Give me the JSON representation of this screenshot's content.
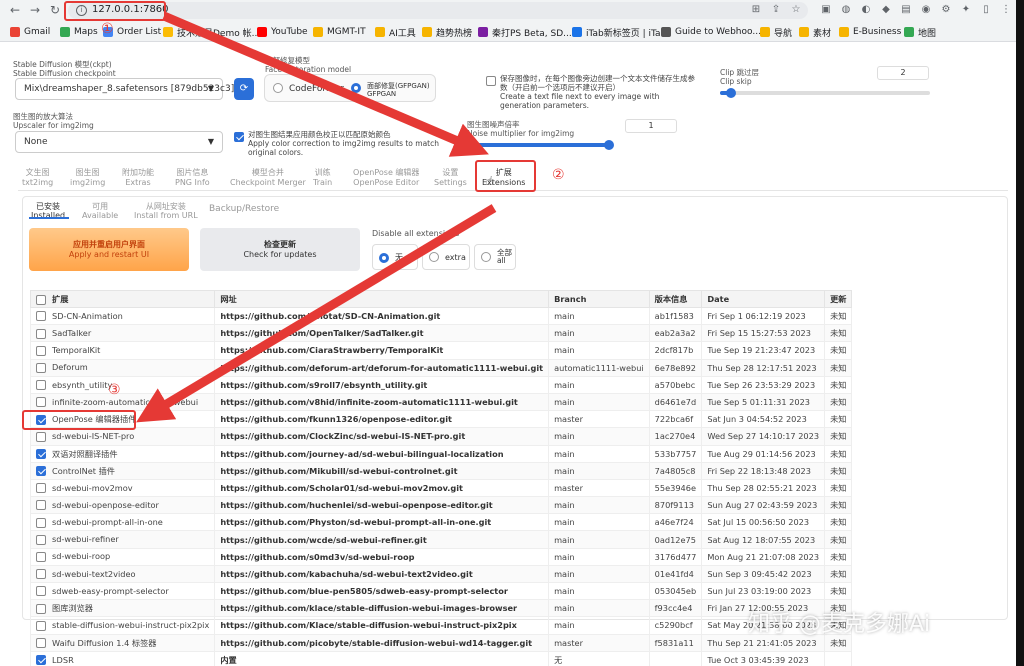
{
  "browser": {
    "url": "127.0.0.1:7860",
    "bookmarks": [
      {
        "label": "Gmail",
        "color": "#ea4335"
      },
      {
        "label": "Maps",
        "color": "#34a853"
      },
      {
        "label": "Order List",
        "color": "#4285f4"
      },
      {
        "label": "技术账号Demo 帐...",
        "color": "#fbbc05"
      },
      {
        "label": "YouTube",
        "color": "#ff0000"
      },
      {
        "label": "MGMT-IT",
        "color": "#f6b400"
      },
      {
        "label": "AI工具",
        "color": "#f6b400"
      },
      {
        "label": "趋势热榜",
        "color": "#f6b400"
      },
      {
        "label": "秦打PS Beta, SD...",
        "color": "#7b1fa2"
      },
      {
        "label": "iTab新标签页 | iTa...",
        "color": "#1a73e8"
      },
      {
        "label": "Guide to Webhoo...",
        "color": "#555"
      },
      {
        "label": "导航",
        "color": "#f6b400"
      },
      {
        "label": "素材",
        "color": "#f6b400"
      },
      {
        "label": "E-Business",
        "color": "#f6b400"
      },
      {
        "label": "地图",
        "color": "#34a853"
      }
    ]
  },
  "settings": {
    "checkpoint_label": "Stable Diffusion 模型(ckpt)",
    "checkpoint_label_en": "Stable Diffusion checkpoint",
    "checkpoint_value": "Mix\\dreamshaper_8.safetensors [879db523c3]",
    "face_label": "面部修复模型",
    "face_label_en": "Face restoration model",
    "face_opt1": "CodeFormer",
    "face_opt2": "面部修复(GFPGAN)",
    "face_opt2_en": "GFPGAN",
    "save_text_label": "保存图像时，在每个图像旁边创建一个文本文件储存生成参数（开启前一个选项后不建议开启）",
    "save_text_label_en": "Create a text file next to every image with generation parameters.",
    "clip_label": "Clip 跳过层",
    "clip_label_en": "Clip skip",
    "clip_value": "2",
    "upscaler_label": "图生图的放大算法",
    "upscaler_label_en": "Upscaler for img2img",
    "upscaler_value": "None",
    "color_corr_label": "对图生图结果应用颜色校正以匹配原始颜色",
    "color_corr_label_en": "Apply color correction to img2img results to match original colors.",
    "noise_label": "图生图噪声倍率",
    "noise_label_en": "Noise multiplier for img2img",
    "noise_value": "1",
    "clip_fraction": 0.05,
    "noise_fraction": 1.0
  },
  "tabs": [
    {
      "zh": "文生图",
      "en": "txt2img"
    },
    {
      "zh": "图生图",
      "en": "img2img"
    },
    {
      "zh": "附加功能",
      "en": "Extras"
    },
    {
      "zh": "图片信息",
      "en": "PNG Info"
    },
    {
      "zh": "模型合并",
      "en": "Checkpoint Merger"
    },
    {
      "zh": "训练",
      "en": "Train"
    },
    {
      "zh": "OpenPose 编辑器",
      "en": "OpenPose Editor"
    },
    {
      "zh": "设置",
      "en": "Settings"
    },
    {
      "zh": "扩展",
      "en": "Extensions"
    }
  ],
  "subtabs": [
    {
      "zh": "已安装",
      "en": "Installed"
    },
    {
      "zh": "可用",
      "en": "Available"
    },
    {
      "zh": "从网址安装",
      "en": "Install from URL"
    },
    {
      "zh": "Backup/Restore",
      "en": ""
    }
  ],
  "actions": {
    "apply_zh": "应用并重启用户界面",
    "apply_en": "Apply and restart UI",
    "check_zh": "检查更新",
    "check_en": "Check for updates",
    "disable_label": "Disable all extensions",
    "disable_opt1": "无",
    "disable_opt2": "extra",
    "disable_opt3_zh": "全部",
    "disable_opt3_en": "all"
  },
  "table": {
    "headers": [
      "扩展",
      "网址",
      "Branch",
      "版本信息",
      "Date",
      "更新"
    ],
    "rows": [
      {
        "checked": false,
        "name": "SD-CN-Animation",
        "url": "https://github.com/volotat/SD-CN-Animation.git",
        "branch": "main",
        "version": "ab1f1583",
        "date": "Fri Sep 1 06:12:19 2023",
        "update": "未知"
      },
      {
        "checked": false,
        "name": "SadTalker",
        "url": "https://github.com/OpenTalker/SadTalker.git",
        "branch": "main",
        "version": "eab2a3a2",
        "date": "Fri Sep 15 15:27:53 2023",
        "update": "未知"
      },
      {
        "checked": false,
        "name": "TemporalKit",
        "url": "https://github.com/CiaraStrawberry/TemporalKit",
        "branch": "main",
        "version": "2dcf817b",
        "date": "Tue Sep 19 21:23:47 2023",
        "update": "未知"
      },
      {
        "checked": false,
        "name": "Deforum",
        "url": "https://github.com/deforum-art/deforum-for-automatic1111-webui.git",
        "branch": "automatic1111-webui",
        "version": "6e78e892",
        "date": "Thu Sep 28 12:17:51 2023",
        "update": "未知"
      },
      {
        "checked": false,
        "name": "ebsynth_utility",
        "url": "https://github.com/s9roll7/ebsynth_utility.git",
        "branch": "main",
        "version": "a570bebc",
        "date": "Tue Sep 26 23:53:29 2023",
        "update": "未知"
      },
      {
        "checked": false,
        "name": "infinite-zoom-automatic1111-webui",
        "url": "https://github.com/v8hid/infinite-zoom-automatic1111-webui.git",
        "branch": "main",
        "version": "d6461e7d",
        "date": "Tue Sep 5 01:11:31 2023",
        "update": "未知"
      },
      {
        "checked": true,
        "name": "OpenPose 编辑器插件",
        "url": "https://github.com/fkunn1326/openpose-editor.git",
        "branch": "master",
        "version": "722bca6f",
        "date": "Sat Jun 3 04:54:52 2023",
        "update": "未知"
      },
      {
        "checked": false,
        "name": "sd-webui-IS-NET-pro",
        "url": "https://github.com/ClockZinc/sd-webui-IS-NET-pro.git",
        "branch": "main",
        "version": "1ac270e4",
        "date": "Wed Sep 27 14:10:17 2023",
        "update": "未知"
      },
      {
        "checked": true,
        "name": "双语对照翻译插件",
        "url": "https://github.com/journey-ad/sd-webui-bilingual-localization",
        "branch": "main",
        "version": "533b7757",
        "date": "Tue Aug 29 01:14:56 2023",
        "update": "未知"
      },
      {
        "checked": true,
        "name": "ControlNet 插件",
        "url": "https://github.com/Mikubill/sd-webui-controlnet.git",
        "branch": "main",
        "version": "7a4805c8",
        "date": "Fri Sep 22 18:13:48 2023",
        "update": "未知"
      },
      {
        "checked": false,
        "name": "sd-webui-mov2mov",
        "url": "https://github.com/Scholar01/sd-webui-mov2mov.git",
        "branch": "master",
        "version": "55e3946e",
        "date": "Thu Sep 28 02:55:21 2023",
        "update": "未知"
      },
      {
        "checked": false,
        "name": "sd-webui-openpose-editor",
        "url": "https://github.com/huchenlei/sd-webui-openpose-editor.git",
        "branch": "main",
        "version": "870f9113",
        "date": "Sun Aug 27 02:43:59 2023",
        "update": "未知"
      },
      {
        "checked": false,
        "name": "sd-webui-prompt-all-in-one",
        "url": "https://github.com/Physton/sd-webui-prompt-all-in-one.git",
        "branch": "main",
        "version": "a46e7f24",
        "date": "Sat Jul 15 00:56:50 2023",
        "update": "未知"
      },
      {
        "checked": false,
        "name": "sd-webui-refiner",
        "url": "https://github.com/wcde/sd-webui-refiner.git",
        "branch": "main",
        "version": "0ad12e75",
        "date": "Sat Aug 12 18:07:55 2023",
        "update": "未知"
      },
      {
        "checked": false,
        "name": "sd-webui-roop",
        "url": "https://github.com/s0md3v/sd-webui-roop",
        "branch": "main",
        "version": "3176d477",
        "date": "Mon Aug 21 21:07:08 2023",
        "update": "未知"
      },
      {
        "checked": false,
        "name": "sd-webui-text2video",
        "url": "https://github.com/kabachuha/sd-webui-text2video.git",
        "branch": "main",
        "version": "01e41fd4",
        "date": "Sun Sep 3 09:45:42 2023",
        "update": "未知"
      },
      {
        "checked": false,
        "name": "sdweb-easy-prompt-selector",
        "url": "https://github.com/blue-pen5805/sdweb-easy-prompt-selector",
        "branch": "main",
        "version": "053045eb",
        "date": "Sun Jul 23 03:19:00 2023",
        "update": "未知"
      },
      {
        "checked": false,
        "name": "图库浏览器",
        "url": "https://github.com/klace/stable-diffusion-webui-images-browser",
        "branch": "main",
        "version": "f93cc4e4",
        "date": "Fri Jan 27 12:00:55 2023",
        "update": "未知"
      },
      {
        "checked": false,
        "name": "stable-diffusion-webui-instruct-pix2pix",
        "url": "https://github.com/Klace/stable-diffusion-webui-instruct-pix2pix",
        "branch": "main",
        "version": "c5290bcf",
        "date": "Sat May 20 21:38:00 2023",
        "update": "未知"
      },
      {
        "checked": false,
        "name": "Waifu Diffusion 1.4 标签器",
        "url": "https://github.com/picobyte/stable-diffusion-webui-wd14-tagger.git",
        "branch": "master",
        "version": "f5831a11",
        "date": "Thu Sep 21 21:41:05 2023",
        "update": "未知"
      },
      {
        "checked": true,
        "name": "LDSR",
        "url": "内置",
        "branch": "无",
        "version": "",
        "date": "Tue Oct 3 03:45:39 2023",
        "update": ""
      }
    ]
  },
  "annotations": {
    "n1": "①",
    "n2": "②",
    "n3": "③",
    "arrow_color": "#e53935"
  },
  "watermark": "知乎 @麦克多娜Ai"
}
